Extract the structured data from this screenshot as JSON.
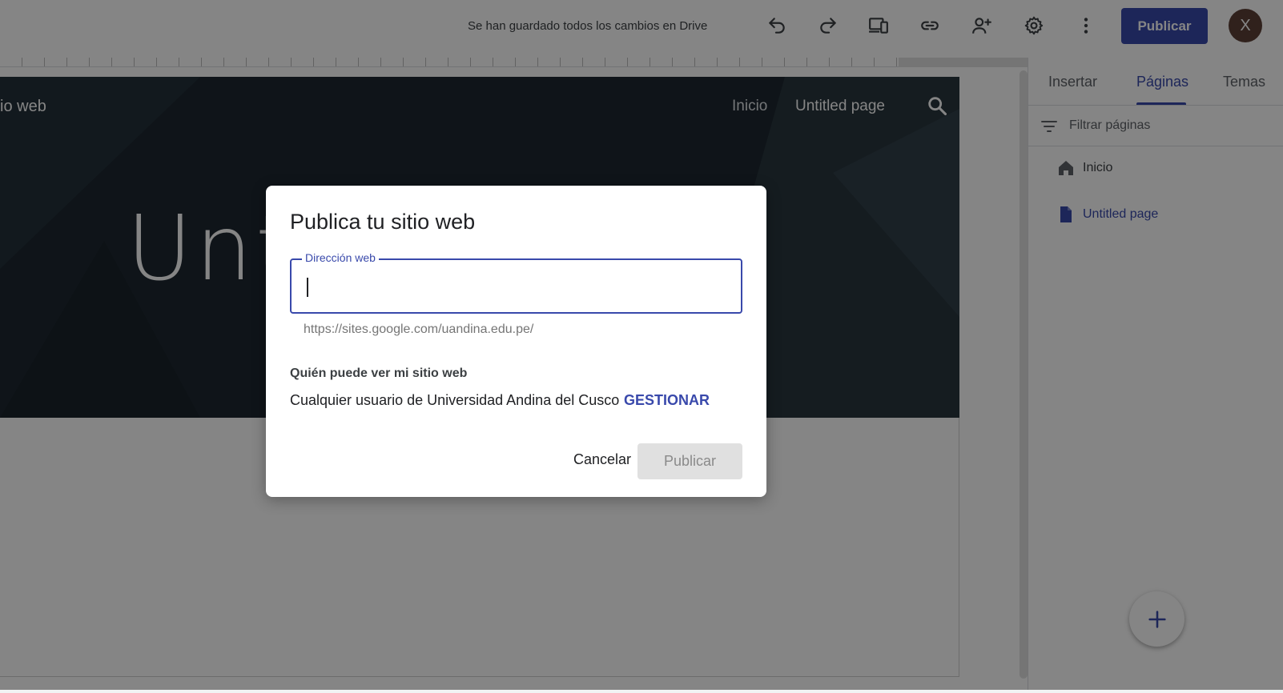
{
  "topbar": {
    "save_status": "Se han guardado todos los cambios en Drive",
    "icons": [
      "undo-icon",
      "redo-icon",
      "devices-preview-icon",
      "link-icon",
      "share-person-add-icon",
      "gear-icon",
      "more-vert-icon"
    ],
    "publish_label": "Publicar",
    "avatar_initial": "X",
    "accent_color": "#3949ab"
  },
  "site": {
    "name_fragment": "io web",
    "nav": {
      "home": "Inicio",
      "page": "Untitled page"
    },
    "hero_title_fragment": "Unt",
    "hero_color": "#1d2830"
  },
  "panel": {
    "tabs": [
      {
        "label": "Insertar",
        "active": false
      },
      {
        "label": "Páginas",
        "active": true
      },
      {
        "label": "Temas",
        "active": false
      }
    ],
    "filter_placeholder": "Filtrar páginas",
    "pages": [
      {
        "label": "Inicio",
        "icon": "home-icon",
        "active": false
      },
      {
        "label": "Untitled page",
        "icon": "page-icon",
        "active": true
      }
    ],
    "fab_icon": "plus-icon"
  },
  "dialog": {
    "title": "Publica tu sitio web",
    "field_label": "Dirección web",
    "field_value": "",
    "field_hint": "https://sites.google.com/uandina.edu.pe/",
    "who_label": "Quién puede ver mi sitio web",
    "who_value": "Cualquier usuario de Universidad Andina del Cusco",
    "manage_label": "GESTIONAR",
    "cancel_label": "Cancelar",
    "publish_label": "Publicar"
  }
}
